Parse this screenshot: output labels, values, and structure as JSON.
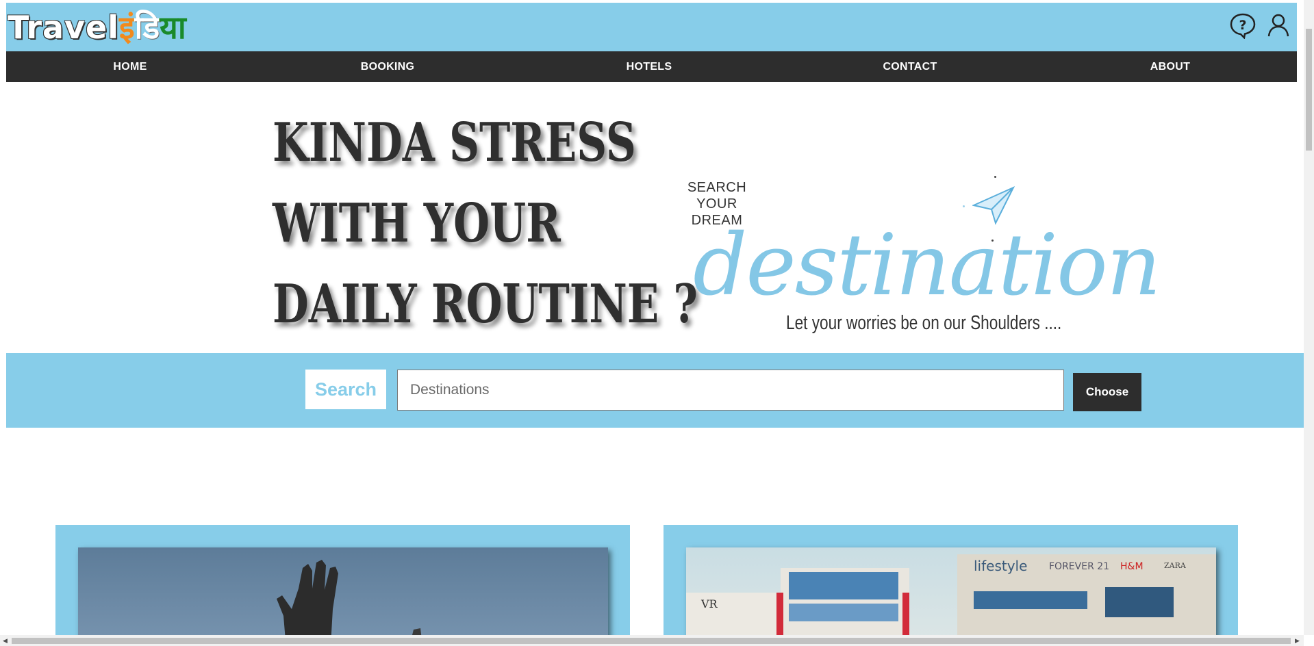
{
  "header": {
    "logo_en": "Travel",
    "logo_hi_1": "इं",
    "logo_hi_2": "डि",
    "logo_hi_3": "या",
    "icons": [
      "help-icon",
      "user-icon"
    ]
  },
  "nav": {
    "items": [
      "HOME",
      "BOOKING",
      "HOTELS",
      "CONTACT",
      "ABOUT"
    ]
  },
  "hero": {
    "lines": [
      "KINDA STRESS",
      "WITH YOUR",
      "DAILY ROUTINE ?"
    ],
    "search_dream": [
      "SEARCH",
      "YOUR",
      "DREAM"
    ],
    "destination": "destination",
    "tagline": "Let your worries be on our Shoulders ...."
  },
  "search": {
    "label": "Search",
    "placeholder": "Destinations",
    "button": "Choose"
  },
  "colors": {
    "accent": "#87cde9",
    "dark": "#2d2d2d",
    "logo_orange": "#f28a1c",
    "logo_green": "#1a8a2a"
  }
}
